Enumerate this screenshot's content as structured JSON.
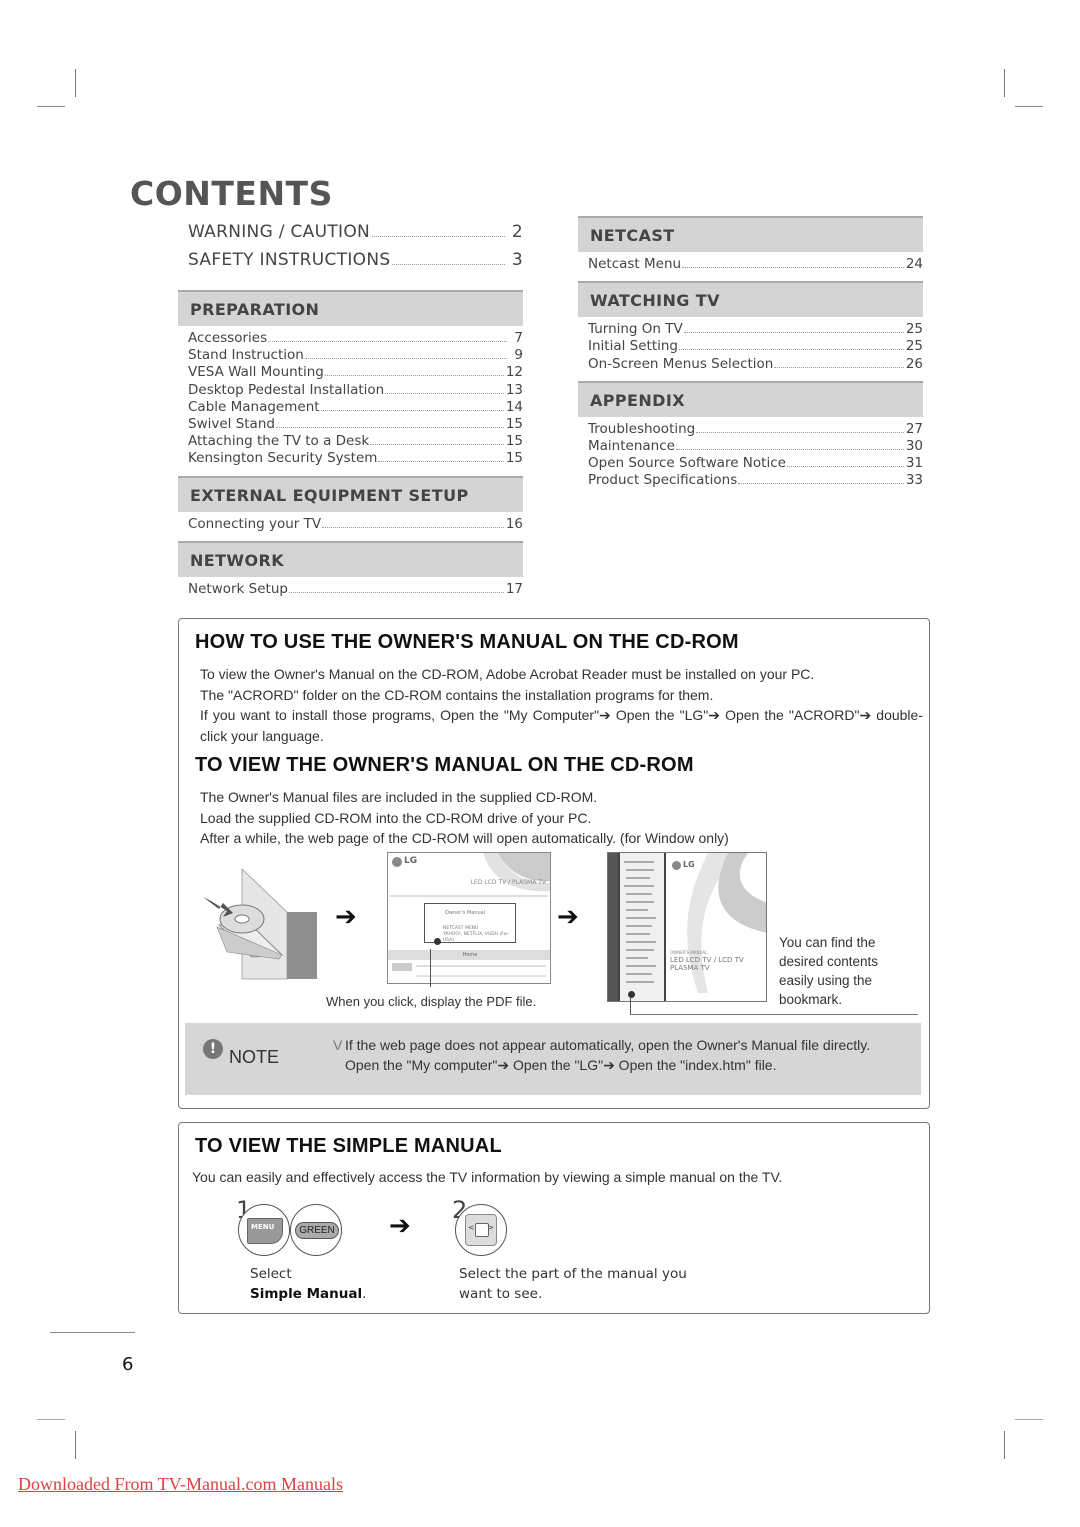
{
  "contents_title": "CONTENTS",
  "top_entries": [
    {
      "title": "WARNING / CAUTION",
      "page": "2"
    },
    {
      "title": "SAFETY INSTRUCTIONS",
      "page": "3"
    }
  ],
  "left_sections": [
    {
      "heading": "PREPARATION",
      "items": [
        {
          "title": "Accessories",
          "page": "7"
        },
        {
          "title": "Stand Instruction",
          "page": "9"
        },
        {
          "title": "VESA Wall Mounting",
          "page": "12"
        },
        {
          "title": "Desktop Pedestal Installation",
          "page": "13"
        },
        {
          "title": "Cable Management",
          "page": "14"
        },
        {
          "title": "Swivel Stand",
          "page": "15"
        },
        {
          "title": "Attaching the TV to a Desk",
          "page": "15"
        },
        {
          "title": "Kensington Security System",
          "page": "15"
        }
      ]
    },
    {
      "heading": "EXTERNAL EQUIPMENT SETUP",
      "items": [
        {
          "title": "Connecting your TV",
          "page": "16"
        }
      ]
    },
    {
      "heading": "NETWORK",
      "items": [
        {
          "title": "Network Setup",
          "page": "17"
        }
      ]
    }
  ],
  "right_sections": [
    {
      "heading": "NETCAST",
      "items": [
        {
          "title": "Netcast Menu",
          "page": "24"
        }
      ]
    },
    {
      "heading": "WATCHING TV",
      "items": [
        {
          "title": "Turning On TV",
          "page": "25"
        },
        {
          "title": "Initial Setting",
          "page": "25"
        },
        {
          "title": "On-Screen Menus Selection",
          "page": "26"
        }
      ]
    },
    {
      "heading": "APPENDIX",
      "items": [
        {
          "title": "Troubleshooting",
          "page": "27"
        },
        {
          "title": "Maintenance",
          "page": "30"
        },
        {
          "title": "Open Source Software Notice",
          "page": "31"
        },
        {
          "title": "Product Specifications",
          "page": "33"
        }
      ]
    }
  ],
  "cd_box": {
    "how_title": "HOW TO USE THE OWNER'S MANUAL ON THE CD-ROM",
    "how_lines": [
      "To view the Owner's Manual on the CD-ROM, Adobe Acrobat Reader must be installed on your PC.",
      "The \"ACRORD\" folder on the CD-ROM contains the installation programs for them.",
      "If you want to install those programs, Open the \"My Computer\"➔ Open the \"LG\"➔ Open the \"ACRORD\"➔ double-click your language."
    ],
    "view_title": "TO VIEW THE OWNER'S MANUAL ON THE CD-ROM",
    "view_lines": [
      "The Owner's Manual files are included in the supplied CD-ROM.",
      "Load the supplied CD-ROM into the CD-ROM drive of your PC.",
      "After a while, the web page of the CD-ROM will open automatically. (for Window only)"
    ],
    "arrow_glyph": "➔",
    "caption_click": "When you click, display the PDF file.",
    "caption_bookmark": "You can find the desired contents easily using the bookmark.",
    "webpage_fig": {
      "brand": "LG",
      "product": "LED LCD TV / PLASMA TV",
      "link1": "Owner's Manual",
      "link2_line1": "NETCAST MENU",
      "link2_line2": "YAHOO!, NETFLIX, VUDU (For USA)",
      "home": "Home"
    },
    "pdf_fig": {
      "brand": "LG",
      "label": "OWNER'S MANUAL",
      "product_line1": "LED LCD TV / LCD TV",
      "product_line2": "PLASMA TV"
    },
    "note": {
      "icon_glyph": "!",
      "label": "NOTE",
      "bullet": "V",
      "line1": "If the web page does not appear automatically, open the Owner's Manual file directly.",
      "line2": "Open the \"My computer\"➔ Open the \"LG\"➔ Open the \"index.htm\" file."
    }
  },
  "simple_box": {
    "title": "TO VIEW THE SIMPLE MANUAL",
    "intro": "You can easily and effectively access the TV information by viewing a simple manual on the TV.",
    "step1_number": "1",
    "step1_key1": "MENU",
    "step1_key2": "GREEN",
    "step1_text": "Select",
    "step1_bold": "Simple Manual",
    "step1_suffix": ".",
    "step2_number": "2",
    "step2_left": "<",
    "step2_right": ">",
    "step2_text_line1": "Select the part of the manual you",
    "step2_text_line2": "want to see.",
    "arrow_glyph": "➔"
  },
  "page_number": "6",
  "download_link": "Downloaded From TV-Manual.com Manuals"
}
